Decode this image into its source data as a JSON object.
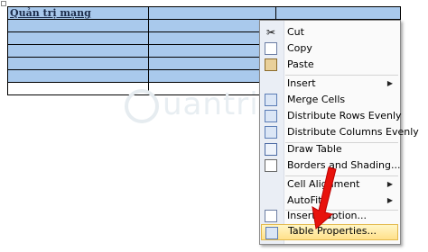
{
  "document": {
    "table_title": "Quản trị mạng"
  },
  "watermark": {
    "text": "uantrimang"
  },
  "context_menu": {
    "items": [
      {
        "label": "Cut",
        "icon": "scissors-icon"
      },
      {
        "label": "Copy",
        "icon": "copy-icon"
      },
      {
        "label": "Paste",
        "icon": "paste-icon"
      },
      {
        "label": "Insert",
        "icon": "",
        "submenu": true
      },
      {
        "label": "Merge Cells",
        "icon": "merge-cells-icon"
      },
      {
        "label": "Distribute Rows Evenly",
        "icon": "distribute-rows-icon"
      },
      {
        "label": "Distribute Columns Evenly",
        "icon": "distribute-columns-icon"
      },
      {
        "label": "Draw Table",
        "icon": "draw-table-icon"
      },
      {
        "label": "Borders and Shading...",
        "icon": "borders-shading-icon"
      },
      {
        "label": "Cell Alignment",
        "icon": "",
        "submenu": true
      },
      {
        "label": "AutoFit",
        "icon": "",
        "submenu": true
      },
      {
        "label": "Insert Caption...",
        "icon": "insert-caption-icon"
      },
      {
        "label": "Table Properties...",
        "icon": "table-properties-icon",
        "highlighted": true
      }
    ]
  },
  "colors": {
    "selection": "#a9c9ec",
    "menu_highlight": "#ffe08a",
    "arrow": "#e8120c"
  }
}
